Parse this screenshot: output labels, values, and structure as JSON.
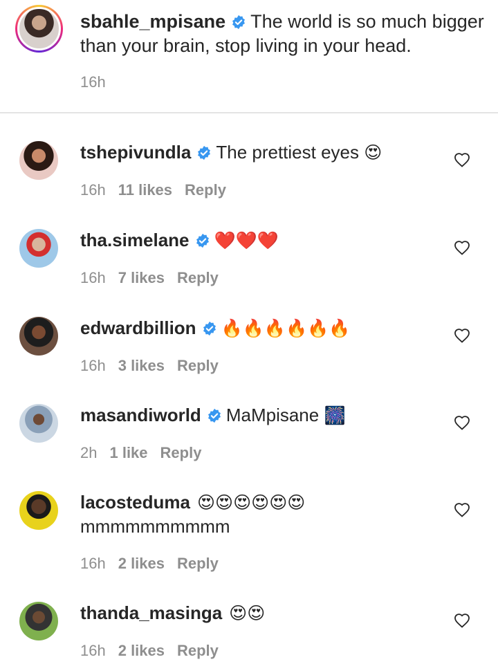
{
  "caption": {
    "username": "sbahle_mpisane",
    "text": "The world is so much bigger than your brain, stop living in your head.",
    "time": "16h",
    "avatar_icon": "profile-photo-woman"
  },
  "comments": [
    {
      "username": "tshepivundla",
      "verified": true,
      "text": "The prettiest eyes",
      "emoji": "😍",
      "time": "16h",
      "likes": "11 likes",
      "reply": "Reply"
    },
    {
      "username": "tha.simelane",
      "verified": true,
      "text": "",
      "emoji": "❤️❤️❤️",
      "time": "16h",
      "likes": "7 likes",
      "reply": "Reply"
    },
    {
      "username": "edwardbillion",
      "verified": true,
      "text": "",
      "emoji": "🔥🔥🔥🔥🔥🔥",
      "time": "16h",
      "likes": "3 likes",
      "reply": "Reply"
    },
    {
      "username": "masandiworld",
      "verified": true,
      "text": "MaMpisane",
      "emoji": "🎆",
      "time": "2h",
      "likes": "1 like",
      "reply": "Reply"
    },
    {
      "username": "lacosteduma",
      "verified": false,
      "text": "",
      "emoji": "😍😍😍😍😍😍",
      "text2": "mmmmmmmmmm",
      "time": "16h",
      "likes": "2 likes",
      "reply": "Reply"
    },
    {
      "username": "thanda_masinga",
      "verified": false,
      "text": "",
      "emoji": "😍😍",
      "time": "16h",
      "likes": "2 likes",
      "reply": "Reply"
    }
  ],
  "colors": {
    "verified": "#3897f0",
    "muted": "#8e8e8e",
    "text": "#262626",
    "divider": "#e3e3e3"
  },
  "icons": {
    "verified": "verified-badge-icon",
    "like": "heart-outline-icon"
  }
}
